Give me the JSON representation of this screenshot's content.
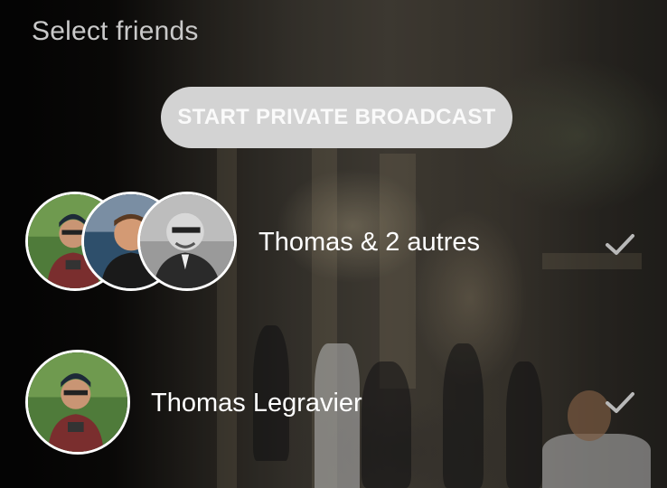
{
  "header": {
    "title": "Select friends"
  },
  "actions": {
    "start_private_broadcast_label": "START PRIVATE BROADCAST"
  },
  "friends": [
    {
      "name": "Thomas & 2 autres",
      "avatars": [
        "thomas-avatar",
        "second-friend-avatar",
        "third-friend-avatar"
      ],
      "checked_icon": "check-icon"
    },
    {
      "name": "Thomas Legravier",
      "avatars": [
        "thomas-avatar"
      ],
      "checked_icon": "check-icon"
    }
  ],
  "colors": {
    "button_bg": "#d3d3d3",
    "button_text": "#fafafa",
    "title_text": "#c9c9c9",
    "avatar_border": "#ffffff",
    "check": "#b8b8b8"
  }
}
